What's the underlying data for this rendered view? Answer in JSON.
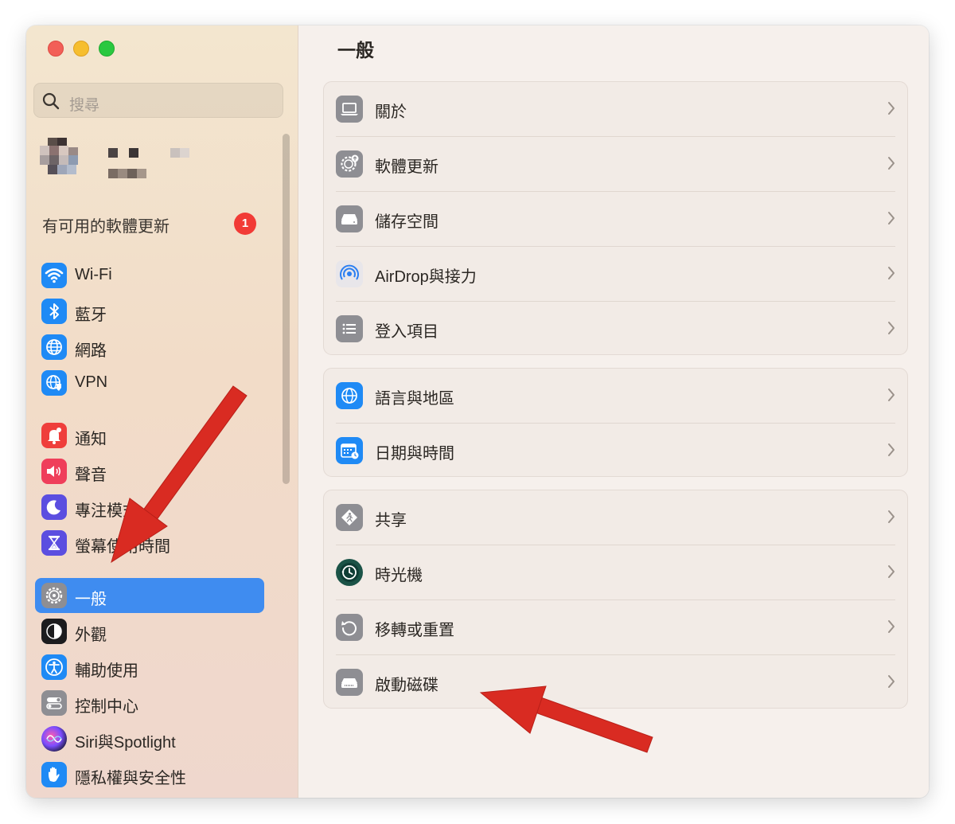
{
  "sidebar": {
    "search_placeholder": "搜尋",
    "update": {
      "label": "有可用的軟體更新",
      "badge": "1"
    },
    "groups": [
      [
        {
          "label": "Wi-Fi",
          "icon": "wifi-icon"
        },
        {
          "label": "藍牙",
          "icon": "bluetooth-icon"
        },
        {
          "label": "網路",
          "icon": "globe-network-icon"
        },
        {
          "label": "VPN",
          "icon": "vpn-icon"
        }
      ],
      [
        {
          "label": "通知",
          "icon": "bell-icon"
        },
        {
          "label": "聲音",
          "icon": "speaker-icon"
        },
        {
          "label": "專注模式",
          "icon": "moon-icon"
        },
        {
          "label": "螢幕使用時間",
          "icon": "hourglass-icon"
        }
      ],
      [
        {
          "label": "一般",
          "icon": "gear-icon",
          "selected": true
        },
        {
          "label": "外觀",
          "icon": "appearance-icon"
        },
        {
          "label": "輔助使用",
          "icon": "accessibility-icon"
        },
        {
          "label": "控制中心",
          "icon": "control-center-icon"
        },
        {
          "label": "Siri與Spotlight",
          "icon": "siri-icon"
        },
        {
          "label": "隱私權與安全性",
          "icon": "hand-icon"
        }
      ]
    ]
  },
  "main": {
    "title": "一般",
    "groups": [
      [
        {
          "label": "關於",
          "icon": "laptop-icon"
        },
        {
          "label": "軟體更新",
          "icon": "gear-badge-icon"
        },
        {
          "label": "儲存空間",
          "icon": "drive-icon"
        },
        {
          "label": "AirDrop與接力",
          "icon": "airdrop-icon"
        },
        {
          "label": "登入項目",
          "icon": "list-icon"
        }
      ],
      [
        {
          "label": "語言與地區",
          "icon": "globe-icon"
        },
        {
          "label": "日期與時間",
          "icon": "calendar-clock-icon"
        }
      ],
      [
        {
          "label": "共享",
          "icon": "sharing-icon"
        },
        {
          "label": "時光機",
          "icon": "time-machine-icon"
        },
        {
          "label": "移轉或重置",
          "icon": "reset-icon"
        },
        {
          "label": "啟動磁碟",
          "icon": "startup-disk-icon"
        }
      ]
    ]
  },
  "colors": {
    "accent": "#3f8cf0",
    "badge": "#f23b36",
    "annotation_arrow": "#d92b22"
  }
}
